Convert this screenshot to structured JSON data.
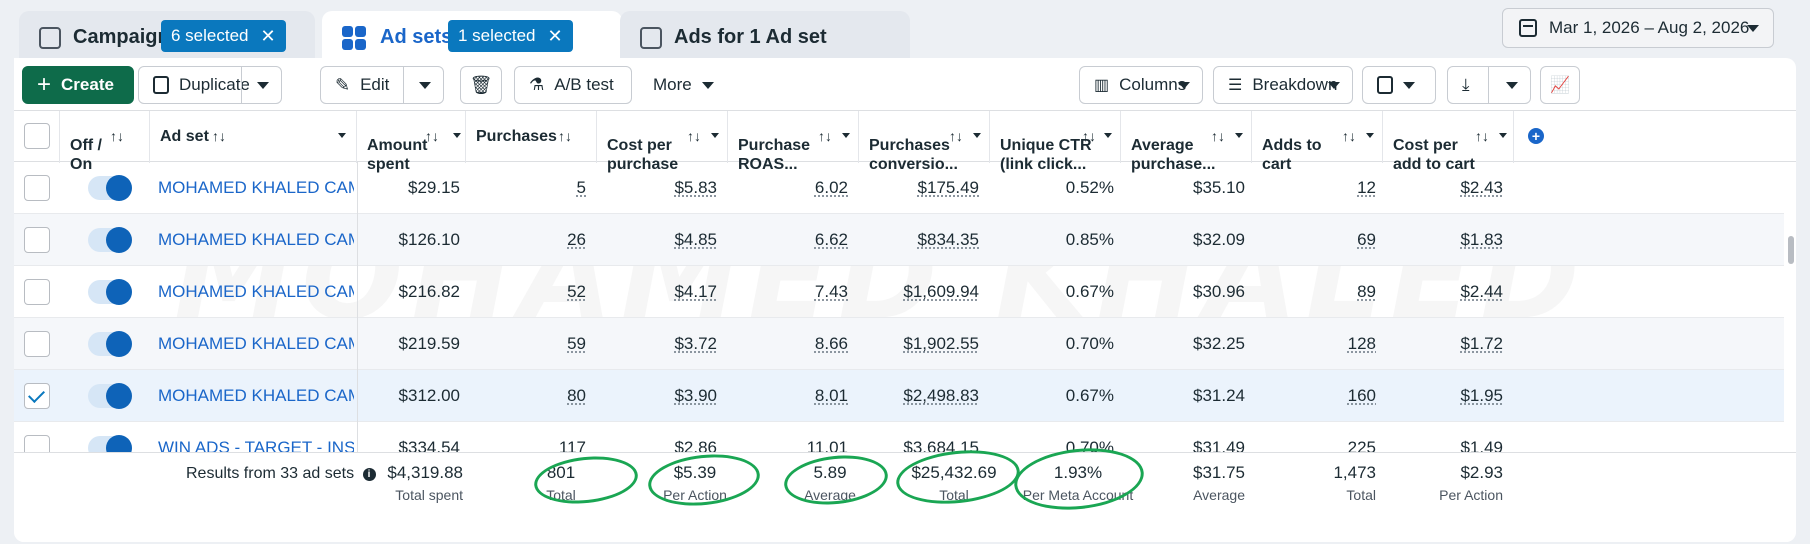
{
  "tabs": {
    "campaigns": {
      "label": "Campaigns",
      "badge": "6 selected"
    },
    "adsets": {
      "label": "Ad sets",
      "badge": "1 selected"
    },
    "ads": {
      "label": "Ads for 1 Ad set"
    }
  },
  "date_range": "Mar 1, 2026 – Aug 2, 2026",
  "toolbar": {
    "create": "Create",
    "duplicate": "Duplicate",
    "edit": "Edit",
    "ab_test": "A/B test",
    "more": "More",
    "columns": "Columns",
    "breakdown": "Breakdown"
  },
  "headers": {
    "off_on": "Off /\nOn",
    "ad_set": "Ad set",
    "amount_spent": "Amount\nspent",
    "purchases": "Purchases",
    "cost_per_purchase": "Cost per\npurchase",
    "purchase_roas": "Purchase\nROAS...",
    "purchases_conv": "Purchases\nconversio...",
    "unique_ctr": "Unique CTR\n(link click...",
    "avg_purchase": "Average\npurchase...",
    "adds_to_cart": "Adds to\ncart",
    "cost_per_atc": "Cost per\nadd to cart"
  },
  "rows": [
    {
      "name": "MOHAMED KHALED CAMP...",
      "spent": "$29.15",
      "purchases": "5",
      "cpp": "$5.83",
      "roas": "6.02",
      "conv": "$175.49",
      "ctr": "0.52%",
      "avg": "$35.10",
      "atc": "12",
      "cpatc": "$2.43",
      "checked": false
    },
    {
      "name": "MOHAMED KHALED CAMP...",
      "spent": "$126.10",
      "purchases": "26",
      "cpp": "$4.85",
      "roas": "6.62",
      "conv": "$834.35",
      "ctr": "0.85%",
      "avg": "$32.09",
      "atc": "69",
      "cpatc": "$1.83",
      "checked": false
    },
    {
      "name": "MOHAMED KHALED CAMP...",
      "spent": "$216.82",
      "purchases": "52",
      "cpp": "$4.17",
      "roas": "7.43",
      "conv": "$1,609.94",
      "ctr": "0.67%",
      "avg": "$30.96",
      "atc": "89",
      "cpatc": "$2.44",
      "checked": false
    },
    {
      "name": "MOHAMED KHALED CAMP...",
      "spent": "$219.59",
      "purchases": "59",
      "cpp": "$3.72",
      "roas": "8.66",
      "conv": "$1,902.55",
      "ctr": "0.70%",
      "avg": "$32.25",
      "atc": "128",
      "cpatc": "$1.72",
      "checked": false
    },
    {
      "name": "MOHAMED KHALED CAMP...",
      "spent": "$312.00",
      "purchases": "80",
      "cpp": "$3.90",
      "roas": "8.01",
      "conv": "$2,498.83",
      "ctr": "0.67%",
      "avg": "$31.24",
      "atc": "160",
      "cpatc": "$1.95",
      "checked": true
    },
    {
      "name": "WIN ADS - TARGET - INSTA",
      "spent": "$334.54",
      "purchases": "117",
      "cpp": "$2.86",
      "roas": "11.01",
      "conv": "$3,684.15",
      "ctr": "0.70%",
      "avg": "$31.49",
      "atc": "225",
      "cpatc": "$1.49",
      "checked": false
    }
  ],
  "summary": {
    "label": "Results from 33 ad sets",
    "spent": {
      "v": "$4,319.88",
      "l": "Total spent"
    },
    "purchases": {
      "v": "801",
      "l": "Total"
    },
    "cpp": {
      "v": "$5.39",
      "l": "Per Action"
    },
    "roas": {
      "v": "5.89",
      "l": "Average"
    },
    "conv": {
      "v": "$25,432.69",
      "l": "Total"
    },
    "ctr": {
      "v": "1.93%",
      "l": "Per Meta Account"
    },
    "avg": {
      "v": "$31.75",
      "l": "Average"
    },
    "atc": {
      "v": "1,473",
      "l": "Total"
    },
    "cpatc": {
      "v": "$2.93",
      "l": "Per Action"
    }
  },
  "watermark": "MOHAMED KHALED",
  "colors": {
    "accent": "#1a66c9",
    "create": "#0e6b4a",
    "highlight": "#1aa653"
  }
}
